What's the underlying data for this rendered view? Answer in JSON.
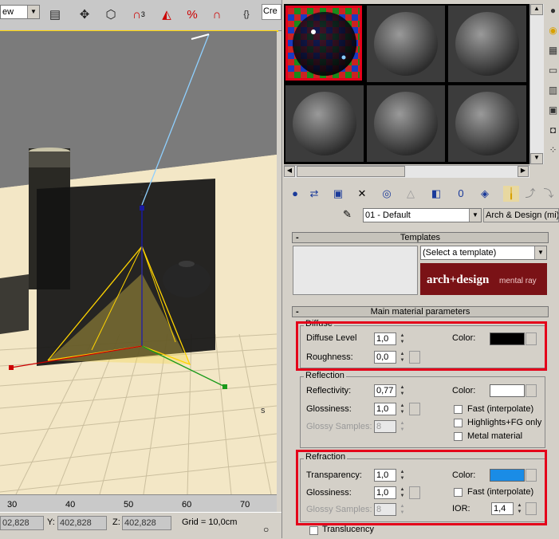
{
  "toolbar": {
    "view_dropdown": "ew",
    "create_field": "Cre",
    "snap_3d_label": "3"
  },
  "viewport": {
    "axis_z": "z",
    "axis_s": "s"
  },
  "ruler": {
    "ticks": [
      "30",
      "40",
      "50",
      "60",
      "70"
    ]
  },
  "status": {
    "x_value": "02,828",
    "y_label": "Y:",
    "y_value": "402,828",
    "z_label": "Z:",
    "z_value": "402,828",
    "grid": "Grid = 10,0cm"
  },
  "material_editor": {
    "material_name": "01 - Default",
    "material_type": "Arch & Design (mi)",
    "templates_rollout": "Templates",
    "template_select": "(Select a template)",
    "banner_brand": "arch+design",
    "banner_sub": "mental ray",
    "main_rollout": "Main material parameters",
    "diffuse": {
      "title": "Diffuse",
      "level_label": "Diffuse Level",
      "level_value": "1,0",
      "roughness_label": "Roughness:",
      "roughness_value": "0,0",
      "color_label": "Color:",
      "color": "#000000"
    },
    "reflection": {
      "title": "Reflection",
      "reflectivity_label": "Reflectivity:",
      "reflectivity_value": "0,77",
      "glossiness_label": "Glossiness:",
      "glossiness_value": "1,0",
      "samples_label": "Glossy Samples:",
      "samples_value": "8",
      "color_label": "Color:",
      "color": "#ffffff",
      "fast_label": "Fast (interpolate)",
      "highlights_label": "Highlights+FG only",
      "metal_label": "Metal material"
    },
    "refraction": {
      "title": "Refraction",
      "transparency_label": "Transparency:",
      "transparency_value": "1,0",
      "glossiness_label": "Glossiness:",
      "glossiness_value": "1,0",
      "samples_label": "Glossy Samples:",
      "samples_value": "8",
      "color_label": "Color:",
      "color": "#1a8ce6",
      "fast_label": "Fast (interpolate)",
      "ior_label": "IOR:",
      "ior_value": "1,4"
    },
    "translucency_label": "Translucency"
  },
  "colors": {
    "highlight_red": "#e4001a",
    "viewport_floor": "#f3e7c6",
    "viewport_border": "#ffd400"
  }
}
